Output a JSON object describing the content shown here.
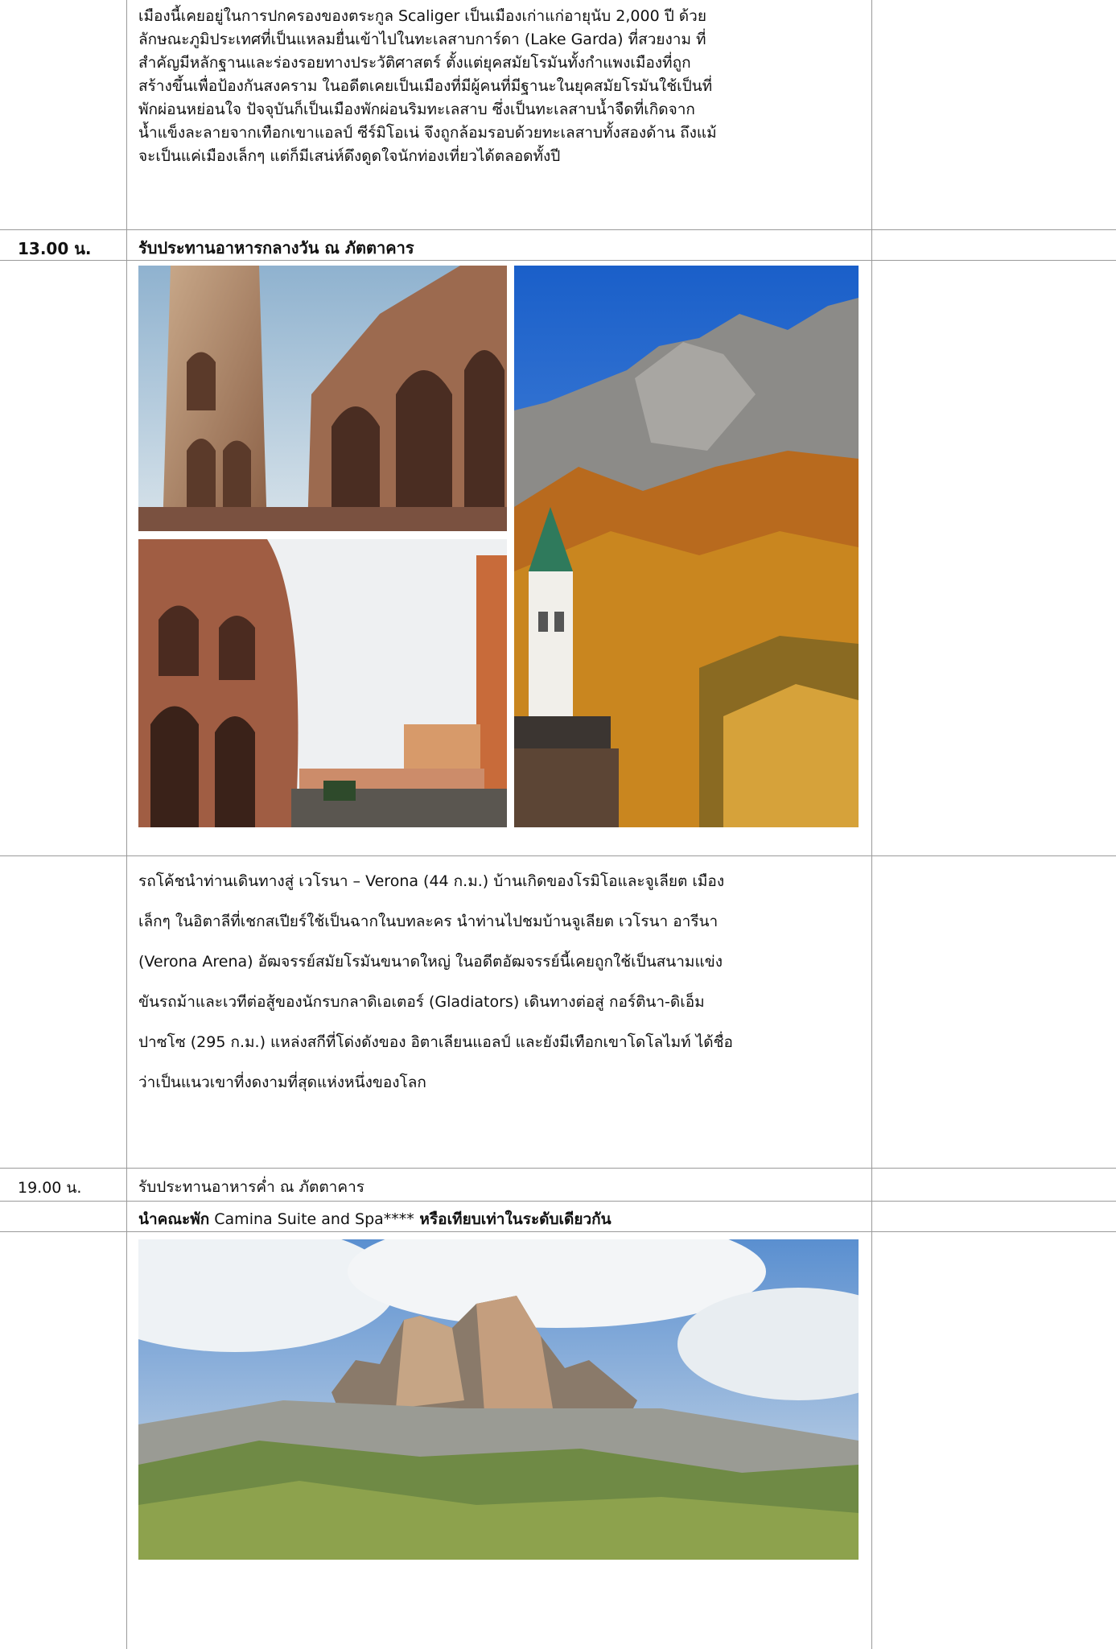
{
  "intro": {
    "lines": [
      "เมืองนี้เคยอยู่ในการปกครองของตระกูล Scaliger เป็นเมืองเก่าแก่อายุนับ 2,000 ปี ด้วย",
      "ลักษณะภูมิประเทศที่เป็นแหลมยื่นเข้าไปในทะเลสาบการ์ดา (Lake Garda) ที่สวยงาม ที่",
      "สำคัญมีหลักฐานและร่องรอยทางประวัติศาสตร์     ตั้งแต่ยุคสมัยโรมันทั้งกำแพงเมืองที่ถูก",
      "สร้างขึ้นเพื่อป้องกันสงคราม  ในอดีตเคยเป็นเมืองที่มีผู้คนที่มีฐานะในยุคสมัยโรมันใช้เป็นที่",
      "พักผ่อนหย่อนใจ  ปัจจุบันก็เป็นเมืองพักผ่อนริมทะเลสาบ  ซึ่งเป็นทะเลสาบน้ำจืดที่เกิดจาก",
      "น้ำแข็งละลายจากเทือกเขาแอลป์ ซีร์มิโอเน่ จึงถูกล้อมรอบด้วยทะเลสาบทั้งสองด้าน ถึงแม้",
      "จะเป็นแค่เมืองเล็กๆ แต่ก็มีเสน่ห์ดึงดูดใจนักท่องเที่ยวได้ตลอดทั้งปี"
    ]
  },
  "lunch": {
    "time": "13.00 น.",
    "text": "รับประทานอาหารกลางวัน ณ ภัตตาคาร"
  },
  "verona": {
    "lines": [
      "รถโค้ชนำท่านเดินทางสู่ เวโรนา – Verona (44 ก.ม.) บ้านเกิดของโรมิโอและจูเลียต เมือง",
      "เล็กๆ ในอิตาลีที่เชกสเปียร์ใช้เป็นฉากในบทละคร นำท่านไปชมบ้านจูเลียต เวโรนา อารีนา",
      "(Verona Arena) อัฒจรรย์สมัยโรมันขนาดใหญ่ ในอดีตอัฒจรรย์นี้เคยถูกใช้เป็นสนามแข่ง",
      "ขันรถม้าและเวทีต่อสู้ของนักรบกลาดิเอเตอร์ (Gladiators) เดินทางต่อสู่ กอร์ตินา-ดิเอ็ม",
      "ปาซโซ (295 ก.ม.) แหล่งสกีที่โด่งดังของ อิตาเลียนแอลป์ และยังมีเทือกเขาโดโลไมท์ ได้ชื่อ",
      "ว่าเป็นแนวเขาที่งดงามที่สุดแห่งหนึ่งของโลก"
    ]
  },
  "dinner": {
    "time": "19.00 น.",
    "text": "รับประทานอาหารค่ำ ณ ภัตตาคาร"
  },
  "hotel": {
    "prefix": "นำคณะพัก",
    "name": " Camina Suite and Spa****",
    "suffix": " หรือเทียบเท่าในระดับเดียวกัน"
  },
  "photos": {
    "arena_top": "verona-arena-arches-photo",
    "arena_bottom": "verona-arena-piazza-photo",
    "cortina": "cortina-dolomites-autumn-photo",
    "dolomites": "tre-cime-dolomites-photo"
  }
}
